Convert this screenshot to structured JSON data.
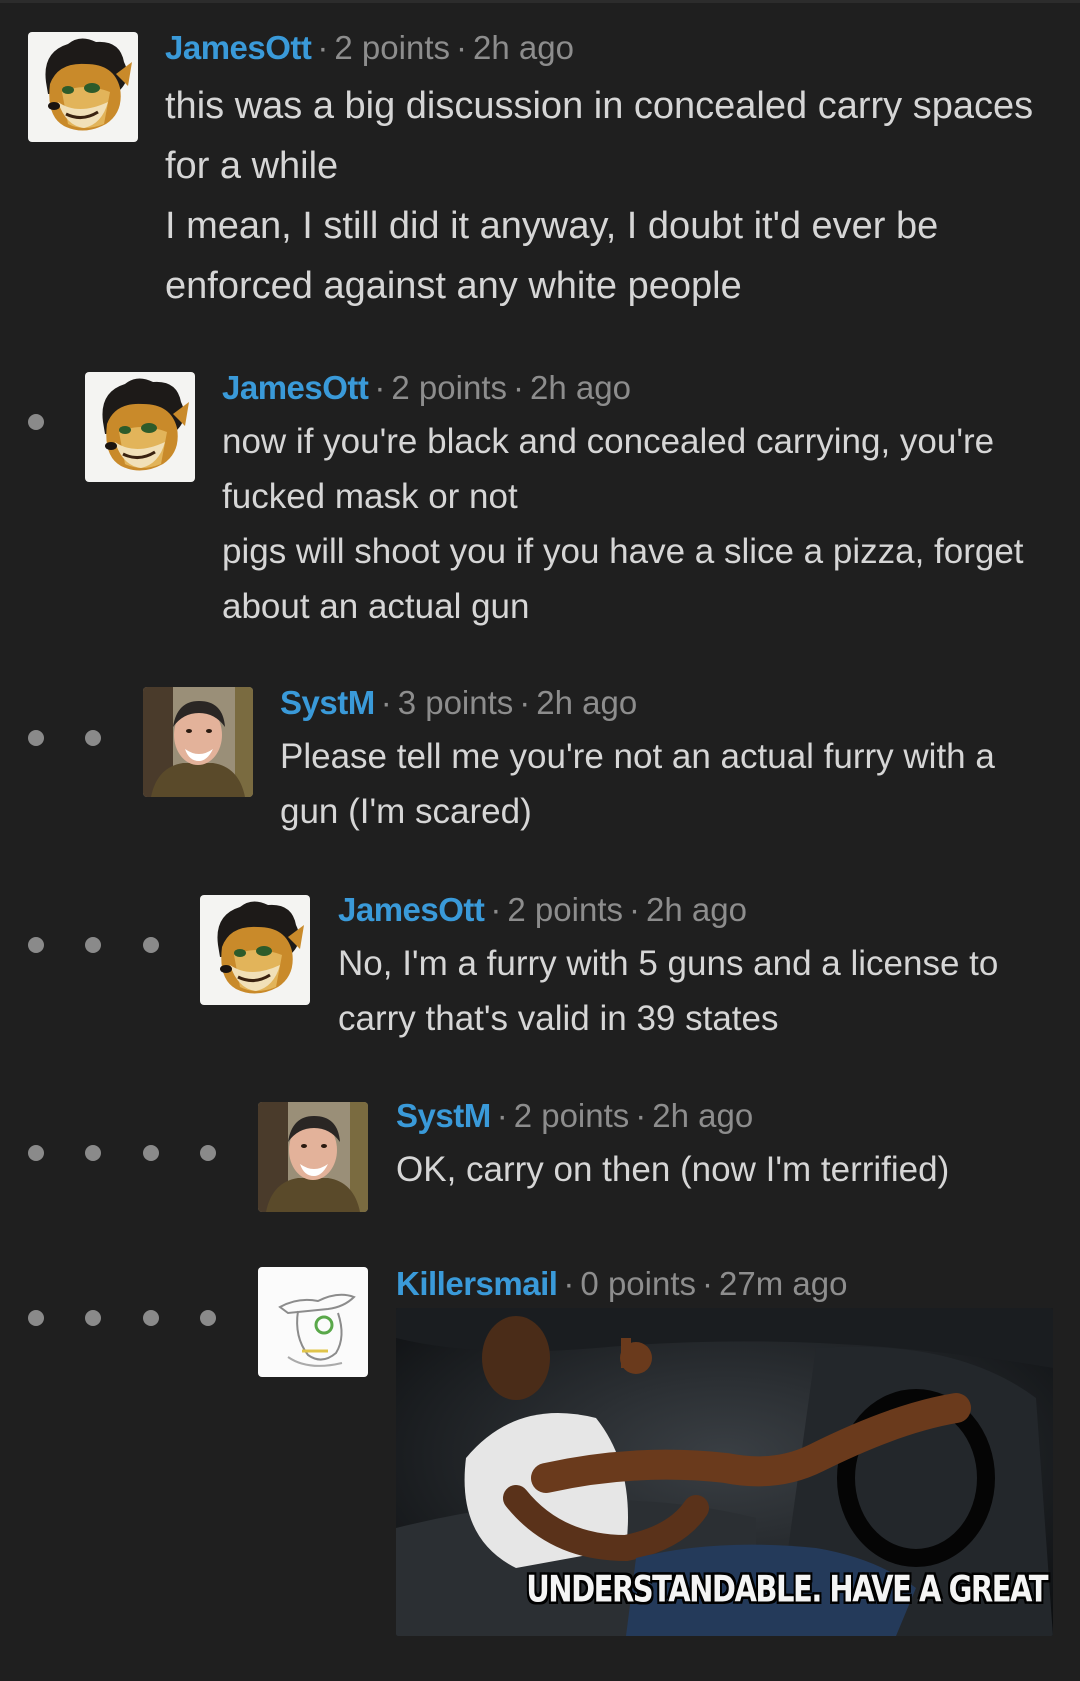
{
  "comments": [
    {
      "author": "JamesOtt",
      "points": "2 points",
      "time": "2h ago",
      "depth": 0,
      "lines": [
        "this was a big discussion in concealed carry spaces for a while",
        "I mean, I still did it anyway, I doubt it'd ever be enforced against any white people"
      ],
      "avatar_icon": "furry-lion-avatar"
    },
    {
      "author": "JamesOtt",
      "points": "2 points",
      "time": "2h ago",
      "depth": 1,
      "lines": [
        "now if you're black and concealed carrying, you're fucked mask or not",
        "pigs will shoot you if you have a slice a pizza, forget about an actual gun"
      ],
      "avatar_icon": "furry-lion-avatar"
    },
    {
      "author": "SystM",
      "points": "3 points",
      "time": "2h ago",
      "depth": 2,
      "lines": [
        "Please tell me you're not an actual furry with a gun (I'm scared)"
      ],
      "avatar_icon": "man-photo-avatar"
    },
    {
      "author": "JamesOtt",
      "points": "2 points",
      "time": "2h ago",
      "depth": 3,
      "lines": [
        "No, I'm a furry with 5 guns and a license to carry that's valid in 39 states"
      ],
      "avatar_icon": "furry-lion-avatar"
    },
    {
      "author": "SystM",
      "points": "2 points",
      "time": "2h ago",
      "depth": 4,
      "lines": [
        "OK, carry on then (now I'm terrified)"
      ],
      "avatar_icon": "man-photo-avatar"
    },
    {
      "author": "Killersmail",
      "points": "0 points",
      "time": "27m ago",
      "depth": 4,
      "lines": [],
      "image_caption": "UNDERSTANDABLE. HAVE A GREAT",
      "avatar_icon": "white-sketch-avatar"
    }
  ],
  "colors": {
    "background": "#1f1f1f",
    "author": "#3a9ad9",
    "meta": "#8d8d8d",
    "text": "#d6d6d6",
    "thread_dot": "#8a8a8a"
  }
}
